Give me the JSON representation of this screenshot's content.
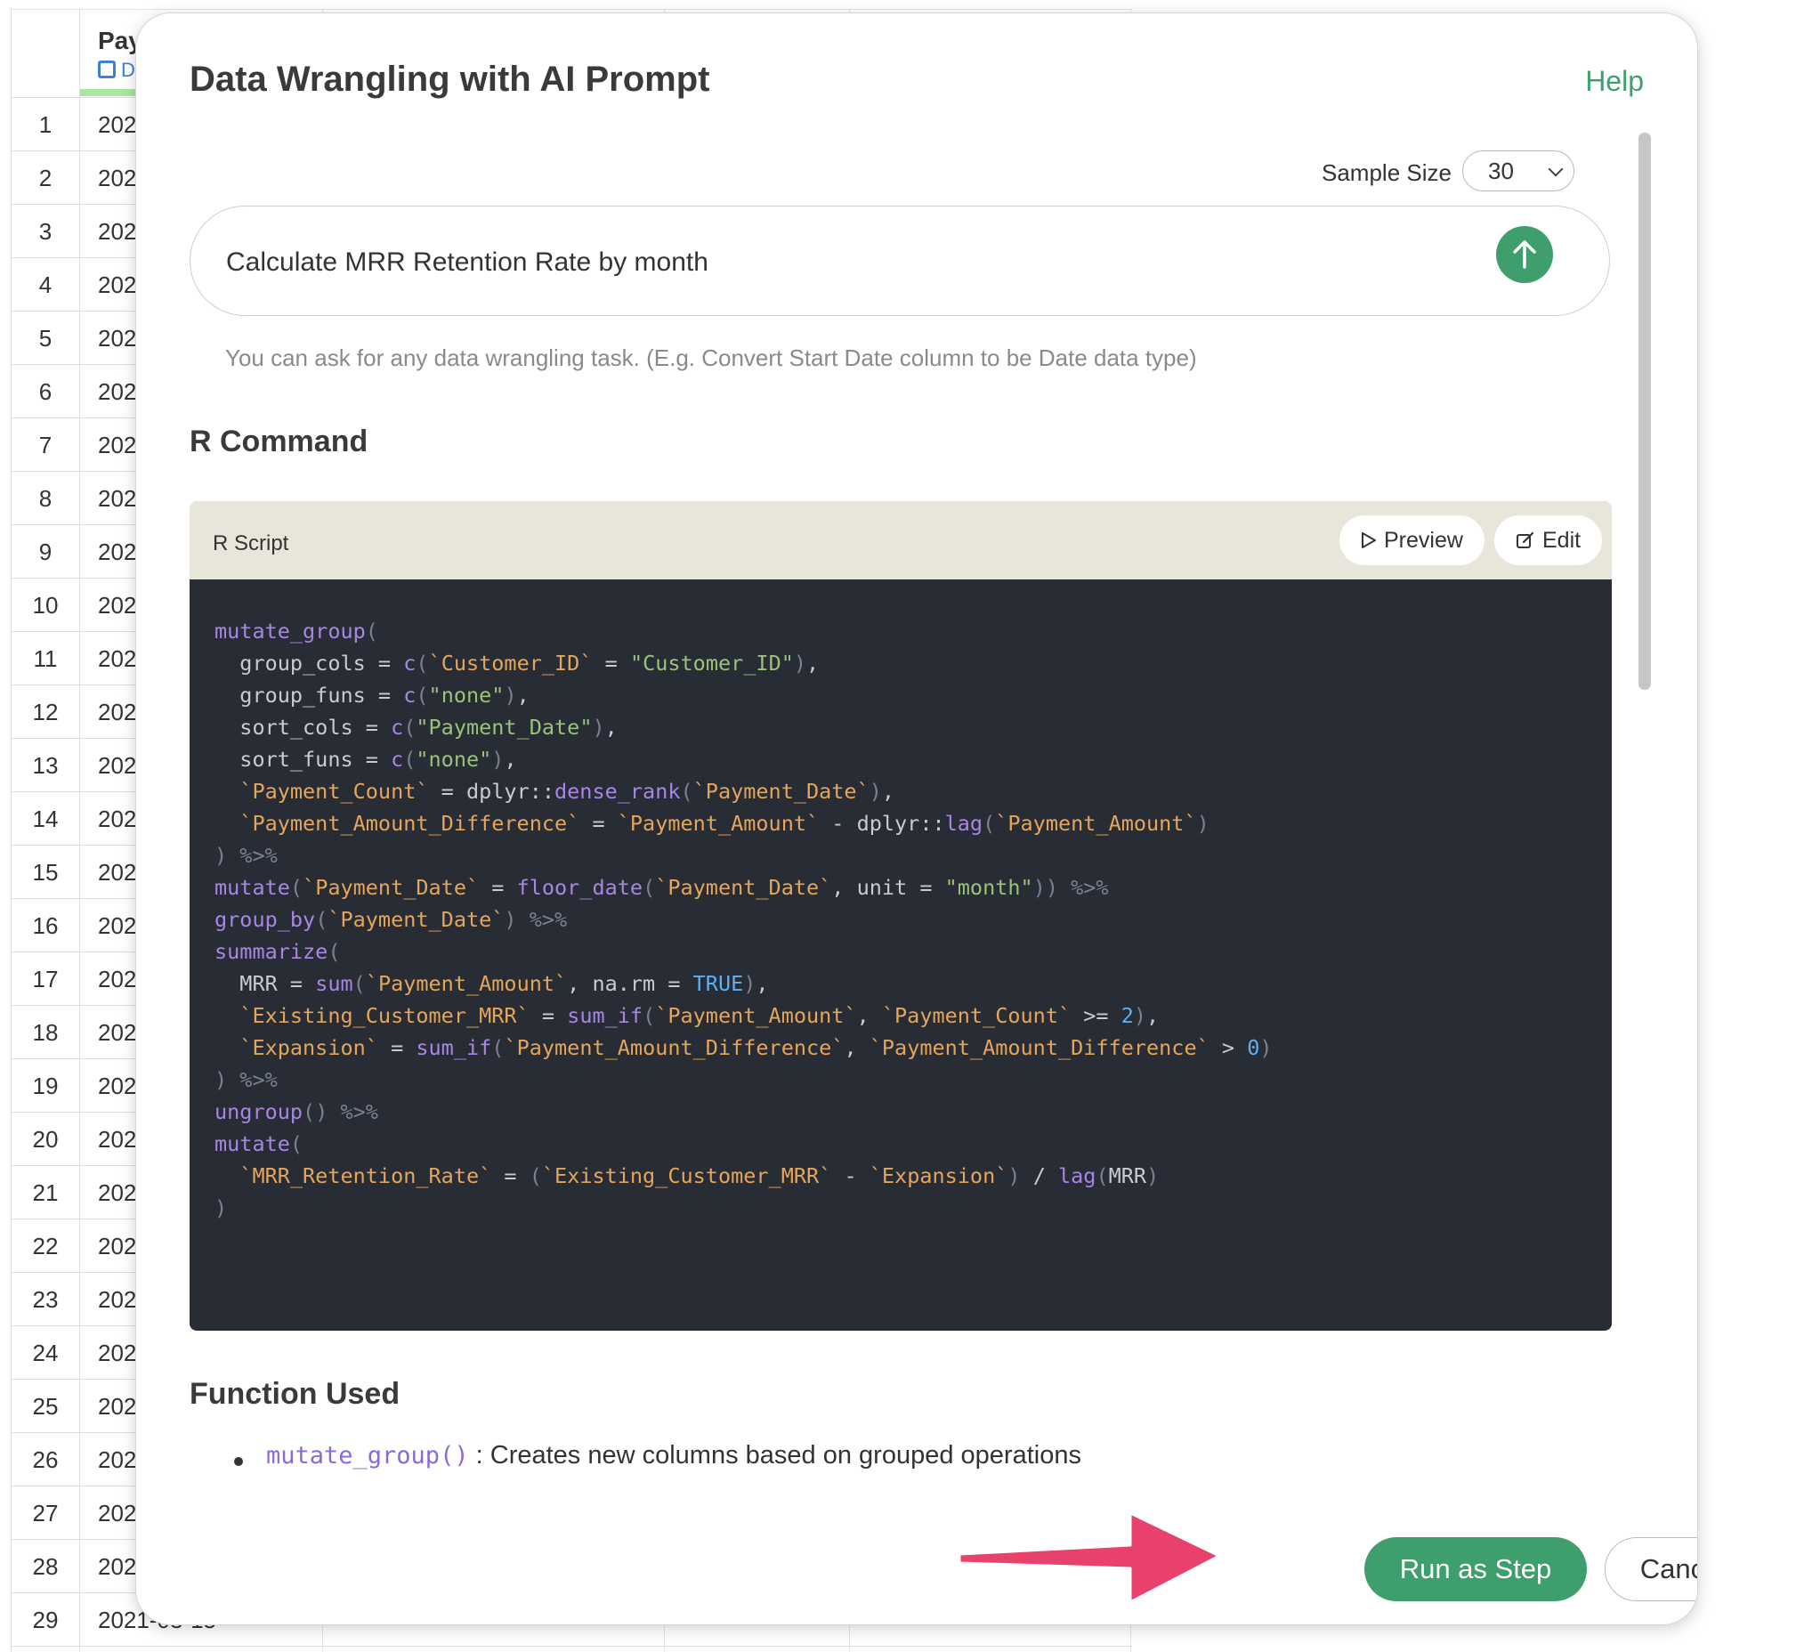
{
  "grid": {
    "column_header": "Pay",
    "column_type": "D",
    "rows": [
      {
        "n": "1",
        "v": "202"
      },
      {
        "n": "2",
        "v": "202"
      },
      {
        "n": "3",
        "v": "202"
      },
      {
        "n": "4",
        "v": "202"
      },
      {
        "n": "5",
        "v": "202"
      },
      {
        "n": "6",
        "v": "202"
      },
      {
        "n": "7",
        "v": "202"
      },
      {
        "n": "8",
        "v": "202"
      },
      {
        "n": "9",
        "v": "202"
      },
      {
        "n": "10",
        "v": "202"
      },
      {
        "n": "11",
        "v": "202"
      },
      {
        "n": "12",
        "v": "202"
      },
      {
        "n": "13",
        "v": "202"
      },
      {
        "n": "14",
        "v": "202"
      },
      {
        "n": "15",
        "v": "202"
      },
      {
        "n": "16",
        "v": "202"
      },
      {
        "n": "17",
        "v": "202"
      },
      {
        "n": "18",
        "v": "202"
      },
      {
        "n": "19",
        "v": "202"
      },
      {
        "n": "20",
        "v": "202"
      },
      {
        "n": "21",
        "v": "202"
      },
      {
        "n": "22",
        "v": "202"
      },
      {
        "n": "23",
        "v": "202"
      },
      {
        "n": "24",
        "v": "202"
      },
      {
        "n": "25",
        "v": "202"
      },
      {
        "n": "26",
        "v": "202"
      },
      {
        "n": "27",
        "v": "202"
      },
      {
        "n": "28",
        "v": "202"
      },
      {
        "n": "29",
        "v": "2021-03-15"
      }
    ]
  },
  "dialog": {
    "title": "Data Wrangling with AI Prompt",
    "help_label": "Help",
    "sample_size_label": "Sample Size",
    "sample_size_value": "30",
    "prompt_value": "Calculate MRR Retention Rate by month",
    "hint": "You can ask for any data wrangling task. (E.g. Convert Start Date column to be Date data type)",
    "r_command_heading": "R Command",
    "script_label": "R Script",
    "preview_label": "Preview",
    "edit_label": "Edit",
    "function_used_heading": "Function Used",
    "functions": [
      {
        "name": "mutate_group()",
        "description": ": Creates new columns based on grouped operations"
      }
    ],
    "run_label": "Run as Step",
    "cancel_label": "Cancel"
  },
  "code_lines": [
    [
      [
        "fn",
        "mutate_group"
      ],
      [
        "pn",
        "("
      ]
    ],
    [
      [
        "",
        "  group_cols = "
      ],
      [
        "fn",
        "c"
      ],
      [
        "pn",
        "("
      ],
      [
        "bt",
        "`Customer_ID`"
      ],
      [
        "",
        " = "
      ],
      [
        "st",
        "\"Customer_ID\""
      ],
      [
        "pn",
        ")"
      ],
      [
        "",
        ","
      ]
    ],
    [
      [
        "",
        "  group_funs = "
      ],
      [
        "fn",
        "c"
      ],
      [
        "pn",
        "("
      ],
      [
        "st",
        "\"none\""
      ],
      [
        "pn",
        ")"
      ],
      [
        "",
        ","
      ]
    ],
    [
      [
        "",
        "  sort_cols = "
      ],
      [
        "fn",
        "c"
      ],
      [
        "pn",
        "("
      ],
      [
        "st",
        "\"Payment_Date\""
      ],
      [
        "pn",
        ")"
      ],
      [
        "",
        ","
      ]
    ],
    [
      [
        "",
        "  sort_funs = "
      ],
      [
        "fn",
        "c"
      ],
      [
        "pn",
        "("
      ],
      [
        "st",
        "\"none\""
      ],
      [
        "pn",
        ")"
      ],
      [
        "",
        ","
      ]
    ],
    [
      [
        "",
        "  "
      ],
      [
        "bt",
        "`Payment_Count`"
      ],
      [
        "",
        " = dplyr::"
      ],
      [
        "fn",
        "dense_rank"
      ],
      [
        "pn",
        "("
      ],
      [
        "bt",
        "`Payment_Date`"
      ],
      [
        "pn",
        ")"
      ],
      [
        "",
        ","
      ]
    ],
    [
      [
        "",
        "  "
      ],
      [
        "bt",
        "`Payment_Amount_Difference`"
      ],
      [
        "",
        " = "
      ],
      [
        "bt",
        "`Payment_Amount`"
      ],
      [
        "",
        " - dplyr::"
      ],
      [
        "fn",
        "lag"
      ],
      [
        "pn",
        "("
      ],
      [
        "bt",
        "`Payment_Amount`"
      ],
      [
        "pn",
        ")"
      ]
    ],
    [
      [
        "pn",
        ") %>%"
      ]
    ],
    [
      [
        "fn",
        "mutate"
      ],
      [
        "pn",
        "("
      ],
      [
        "bt",
        "`Payment_Date`"
      ],
      [
        "",
        " = "
      ],
      [
        "fn",
        "floor_date"
      ],
      [
        "pn",
        "("
      ],
      [
        "bt",
        "`Payment_Date`"
      ],
      [
        "",
        ", unit = "
      ],
      [
        "st",
        "\"month\""
      ],
      [
        "pn",
        "))"
      ],
      [
        "pn",
        " %>%"
      ]
    ],
    [
      [
        "fn",
        "group_by"
      ],
      [
        "pn",
        "("
      ],
      [
        "bt",
        "`Payment_Date`"
      ],
      [
        "pn",
        ")"
      ],
      [
        "pn",
        " %>%"
      ]
    ],
    [
      [
        "fn",
        "summarize"
      ],
      [
        "pn",
        "("
      ]
    ],
    [
      [
        "",
        "  MRR = "
      ],
      [
        "fn",
        "sum"
      ],
      [
        "pn",
        "("
      ],
      [
        "bt",
        "`Payment_Amount`"
      ],
      [
        "",
        ", na.rm = "
      ],
      [
        "nm",
        "TRUE"
      ],
      [
        "pn",
        ")"
      ],
      [
        "",
        ","
      ]
    ],
    [
      [
        "",
        "  "
      ],
      [
        "bt",
        "`Existing_Customer_MRR`"
      ],
      [
        "",
        " = "
      ],
      [
        "fn",
        "sum_if"
      ],
      [
        "pn",
        "("
      ],
      [
        "bt",
        "`Payment_Amount`"
      ],
      [
        "",
        ", "
      ],
      [
        "bt",
        "`Payment_Count`"
      ],
      [
        "",
        " >= "
      ],
      [
        "nm",
        "2"
      ],
      [
        "pn",
        ")"
      ],
      [
        "",
        ","
      ]
    ],
    [
      [
        "",
        "  "
      ],
      [
        "bt",
        "`Expansion`"
      ],
      [
        "",
        " = "
      ],
      [
        "fn",
        "sum_if"
      ],
      [
        "pn",
        "("
      ],
      [
        "bt",
        "`Payment_Amount_Difference`"
      ],
      [
        "",
        ", "
      ],
      [
        "bt",
        "`Payment_Amount_Difference`"
      ],
      [
        "",
        " > "
      ],
      [
        "nm",
        "0"
      ],
      [
        "pn",
        ")"
      ]
    ],
    [
      [
        "pn",
        ") %>%"
      ]
    ],
    [
      [
        "fn",
        "ungroup"
      ],
      [
        "pn",
        "()"
      ],
      [
        "pn",
        " %>%"
      ]
    ],
    [
      [
        "fn",
        "mutate"
      ],
      [
        "pn",
        "("
      ]
    ],
    [
      [
        "",
        "  "
      ],
      [
        "bt",
        "`MRR_Retention_Rate`"
      ],
      [
        "",
        " = "
      ],
      [
        "pn",
        "("
      ],
      [
        "bt",
        "`Existing_Customer_MRR`"
      ],
      [
        "",
        " - "
      ],
      [
        "bt",
        "`Expansion`"
      ],
      [
        "pn",
        ")"
      ],
      [
        "",
        " / "
      ],
      [
        "fn",
        "lag"
      ],
      [
        "pn",
        "("
      ],
      [
        "",
        "MRR"
      ],
      [
        "pn",
        ")"
      ]
    ],
    [
      [
        "pn",
        ")"
      ]
    ]
  ],
  "colors": {
    "accent_green": "#3e9e6c",
    "arrow_pink": "#e8416b",
    "code_bg": "#282c34",
    "script_header_bg": "#e8e5da"
  },
  "icons": {
    "send": "arrow-up-icon",
    "preview": "play-icon",
    "edit": "edit-icon",
    "select": "chevron-down-icon",
    "column_type": "calendar-icon"
  }
}
